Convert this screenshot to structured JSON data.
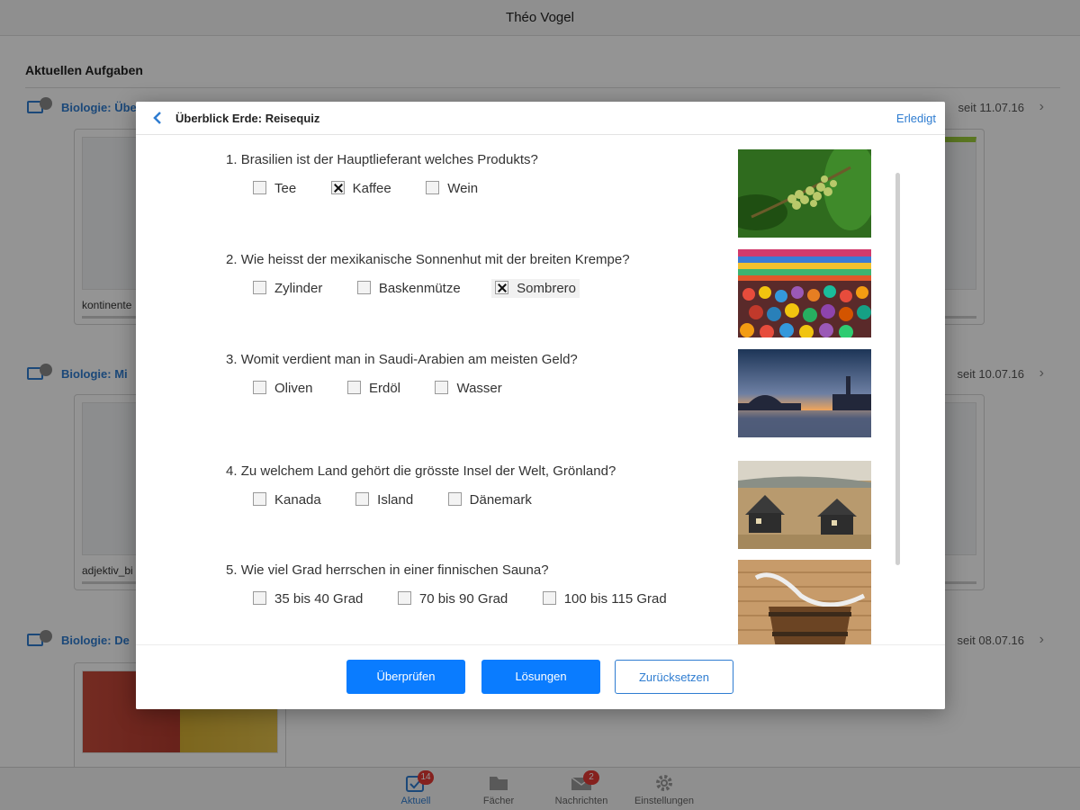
{
  "header": {
    "user_name": "Théo Vogel"
  },
  "current_tasks": {
    "title": "Aktuellen Aufgaben",
    "rows": [
      {
        "title": "Biologie: Überblick Erde",
        "badge": "",
        "date": "seit 11.07.16"
      },
      {
        "title": "Biologie: Mi",
        "badge": "",
        "date": "seit 10.07.16"
      },
      {
        "title": "Biologie: De",
        "badge": "",
        "date": "seit 08.07.16"
      }
    ],
    "cards": [
      {
        "caption": "kontinente"
      },
      {
        "caption": "adjektiv_bi"
      },
      {
        "caption": ""
      }
    ]
  },
  "tabbar": {
    "tabs": [
      {
        "label": "Aktuell",
        "badge": "14",
        "icon": "calendar-check-icon"
      },
      {
        "label": "Fächer",
        "badge": "",
        "icon": "folder-icon"
      },
      {
        "label": "Nachrichten",
        "badge": "2",
        "icon": "envelope-icon"
      },
      {
        "label": "Einstellungen",
        "badge": "",
        "icon": "gear-icon"
      }
    ]
  },
  "modal": {
    "title": "Überblick Erde: Reisequiz",
    "done_label": "Erledigt",
    "questions": [
      {
        "number": "1.",
        "text": "Brasilien ist der Hauptlieferant welches Produkts?",
        "options": [
          "Tee",
          "Kaffee",
          "Wein"
        ],
        "checked": [
          false,
          true,
          false
        ],
        "image": "coffee-plant-image"
      },
      {
        "number": "2.",
        "text": "Wie heisst der mexikanische Sonnenhut mit der breiten Krempe?",
        "options": [
          "Zylinder",
          "Baskenmütze",
          "Sombrero"
        ],
        "checked": [
          false,
          false,
          true
        ],
        "image": "mexican-market-image"
      },
      {
        "number": "3.",
        "text": "Womit verdient man in Saudi-Arabien am meisten Geld?",
        "options": [
          "Oliven",
          "Erdöl",
          "Wasser"
        ],
        "checked": [
          false,
          false,
          false
        ],
        "image": "mosque-sunset-image"
      },
      {
        "number": "4.",
        "text": "Zu welchem Land gehört die grösste Insel der Welt, Grönland?",
        "options": [
          "Kanada",
          "Island",
          "Dänemark"
        ],
        "checked": [
          false,
          false,
          false
        ],
        "image": "greenland-houses-image"
      },
      {
        "number": "5.",
        "text": "Wie viel Grad herrschen in einer finnischen Sauna?",
        "options": [
          "35 bis 40 Grad",
          "70 bis 90 Grad",
          "100 bis 115 Grad"
        ],
        "checked": [
          false,
          false,
          false
        ],
        "image": "sauna-bucket-image"
      }
    ],
    "buttons": {
      "check": "Überprüfen",
      "solutions": "Lösungen",
      "reset": "Zurücksetzen"
    }
  },
  "colors": {
    "accent": "#0a7cff",
    "link": "#2f7dd1",
    "badge": "#e53935",
    "overlay": "rgba(0,0,0,0.42)"
  }
}
